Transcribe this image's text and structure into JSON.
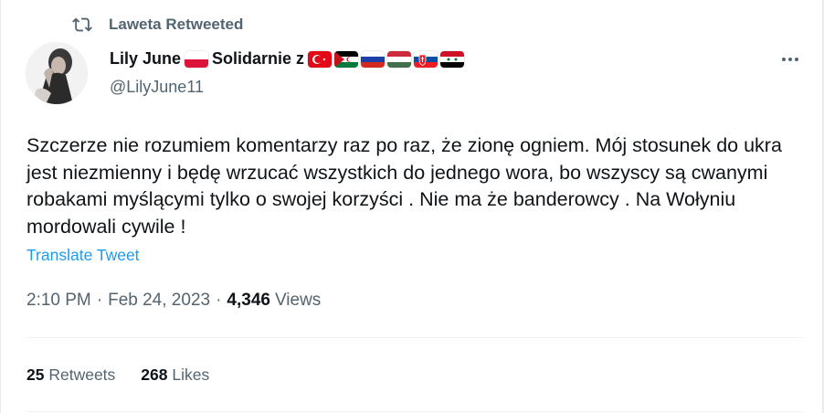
{
  "retweet": {
    "label": "Laweta Retweeted",
    "icon": "retweet-icon"
  },
  "author": {
    "display_name": "Lily June",
    "display_suffix": "Solidarnie z",
    "handle": "@LilyJune11",
    "avatar_icon": "avatar-image",
    "name_flags": [
      "poland-flag"
    ],
    "suffix_flags": [
      "turkey-flag",
      "western-sahara-flag",
      "russia-flag",
      "hungary-flag",
      "slovakia-flag",
      "syria-flag"
    ]
  },
  "tweet": {
    "text": "Szczerze nie rozumiem komentarzy raz po raz, że zionę ogniem. Mój stosunek do ukra jest niezmienny i będę wrzucać wszystkich do jednego wora, bo wszyscy są cwanymi robakami myślącymi tylko o swojej korzyści . Nie ma że banderowcy . Na Wołyniu mordowali cywile !",
    "translate_label": "Translate Tweet",
    "time": "2:10 PM",
    "separator": "·",
    "date": "Feb 24, 2023",
    "views_count": "4,346",
    "views_label": "Views"
  },
  "stats": {
    "retweets_count": "25",
    "retweets_label": "Retweets",
    "likes_count": "268",
    "likes_label": "Likes"
  },
  "colors": {
    "accent": "#1d9bf0",
    "muted": "#536471",
    "text": "#0f1419"
  }
}
